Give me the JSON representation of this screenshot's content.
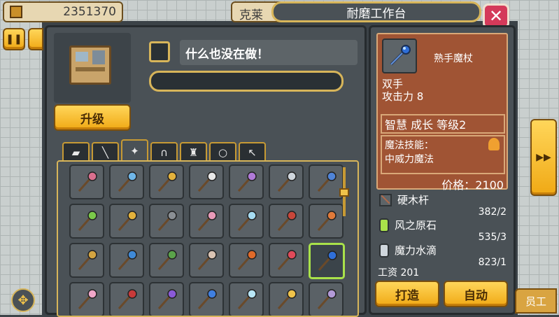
{
  "hud": {
    "money": "2351370",
    "name_partial": "克莱",
    "window_title": "耐磨工作台",
    "pause_icon": "pause-icon",
    "staff_label": "员工"
  },
  "station": {
    "status_text": "什么也没在做！",
    "upgrade_label": "升级"
  },
  "category_tabs": [
    {
      "icon": "shield-tab-icon",
      "glyph": "▰"
    },
    {
      "icon": "spear-tab-icon",
      "glyph": "╲"
    },
    {
      "icon": "staff-tab-icon",
      "glyph": "✦"
    },
    {
      "icon": "helmet-tab-icon",
      "glyph": "∩"
    },
    {
      "icon": "armor-tab-icon",
      "glyph": "♜"
    },
    {
      "icon": "ring-tab-icon",
      "glyph": "○"
    },
    {
      "icon": "bow-tab-icon",
      "glyph": "↖"
    }
  ],
  "staffs": [
    {
      "icon": "staff-pink-orb",
      "c": "#d96f8e"
    },
    {
      "icon": "staff-blue-orb",
      "c": "#6fb6e8"
    },
    {
      "icon": "staff-gold-orb",
      "c": "#e3b23c"
    },
    {
      "icon": "staff-white-orb",
      "c": "#e8e8e8"
    },
    {
      "icon": "staff-purple-crystal",
      "c": "#b07ad8"
    },
    {
      "icon": "staff-silver-rod",
      "c": "#cfd6dc"
    },
    {
      "icon": "staff-blue-crystal",
      "c": "#4f84d8"
    },
    {
      "icon": "staff-green-cross",
      "c": "#7ac94a"
    },
    {
      "icon": "staff-gold-crescent",
      "c": "#e3b23c"
    },
    {
      "icon": "staff-grey-orb",
      "c": "#8a8f94"
    },
    {
      "icon": "staff-pink-wing",
      "c": "#e89ab8"
    },
    {
      "icon": "staff-ice-crystal",
      "c": "#a6dcf2"
    },
    {
      "icon": "staff-red-ring",
      "c": "#c8463a"
    },
    {
      "icon": "staff-orange-sun",
      "c": "#e07a3a"
    },
    {
      "icon": "staff-golden-tree",
      "c": "#d3a441"
    },
    {
      "icon": "staff-blue-sphere",
      "c": "#3f8ad8"
    },
    {
      "icon": "staff-green-twig",
      "c": "#5aa34a"
    },
    {
      "icon": "staff-skull",
      "c": "#d9c3b3"
    },
    {
      "icon": "staff-fire-orb",
      "c": "#e06a2a"
    },
    {
      "icon": "staff-ruby-wand",
      "c": "#e04a5a"
    },
    {
      "icon": "staff-sapphire",
      "c": "#2f6fd8"
    },
    {
      "icon": "staff-pink-feather",
      "c": "#f0a6c8"
    },
    {
      "icon": "staff-red-rose",
      "c": "#c83a3a"
    },
    {
      "icon": "staff-violet-axe",
      "c": "#8a5ad8"
    },
    {
      "icon": "staff-blue-flame",
      "c": "#3f7fe0"
    },
    {
      "icon": "staff-frost-shard",
      "c": "#b8e6f6"
    },
    {
      "icon": "staff-golden-star",
      "c": "#f0c34a"
    },
    {
      "icon": "staff-lavender-hook",
      "c": "#b39ad8"
    }
  ],
  "selected_index": 20,
  "item": {
    "name": "熟手魔杖",
    "type": "双手",
    "attack": "攻击力 8",
    "stats": "智慧 成长 等级2",
    "skill_label": "魔法技能：",
    "skill": "中威力魔法",
    "price": "价格：2100"
  },
  "materials": [
    {
      "name": "硬木杆",
      "count": ""
    },
    {
      "name": "风之原石",
      "count": "382/2"
    },
    {
      "name": "魔力水滴",
      "count": "535/3"
    }
  ],
  "last_count": "823/1",
  "wage": "工资 201",
  "craft_label": "打造",
  "auto_label": "自动",
  "colors": {
    "gold": "#f0a915",
    "panel": "#4a5156",
    "brown": "#a05434",
    "select": "#a9e24a"
  }
}
